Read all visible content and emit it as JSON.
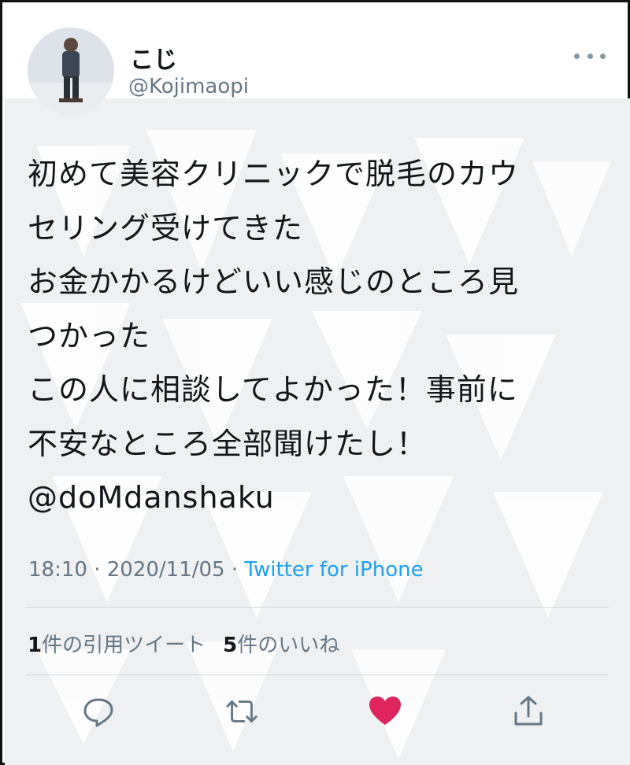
{
  "user": {
    "display_name": "こじ",
    "handle": "@Kojimaopi"
  },
  "tweet": {
    "lines": [
      "初めて美容クリニックで脱毛のカウ",
      "セリング受けてきた",
      "お金かかるけどいい感じのところ見",
      "つかった",
      "この人に相談してよかった！事前に",
      "不安なところ全部聞けたし！",
      "@doMdanshaku"
    ],
    "time": "18:10",
    "separator": "·",
    "date": "2020/11/05",
    "source": "Twitter for iPhone"
  },
  "stats": {
    "quote_count": "1",
    "quote_label": "件の引用ツイート",
    "like_count": "5",
    "like_label": "件のいいね"
  },
  "actions": {
    "reply_icon": "reply-icon",
    "retweet_icon": "retweet-icon",
    "like_icon": "heart-icon",
    "share_icon": "share-icon"
  },
  "colors": {
    "text": "#14171a",
    "secondary": "#657786",
    "link": "#1da1f2",
    "like": "#e0245e",
    "background": "#eef0f2"
  }
}
